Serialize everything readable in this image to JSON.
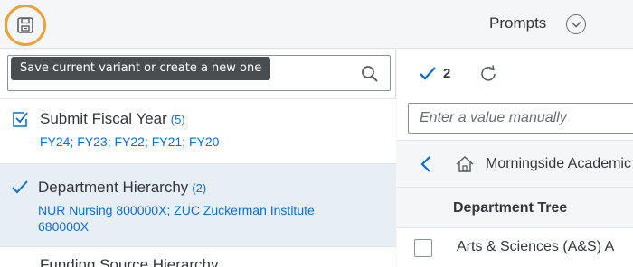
{
  "toolbar": {
    "save_icon": "floppy-disk-icon",
    "prompts_label": "Prompts",
    "prompts_icon": "chevron-down-circle-icon"
  },
  "tooltip": {
    "text": "Save current variant or create a new one"
  },
  "left_panel": {
    "search": {
      "value": "",
      "placeholder": "",
      "icon": "search-icon"
    },
    "items": [
      {
        "title": "Submit Fiscal Year",
        "count": "(5)",
        "values": "FY24; FY23; FY22; FY21; FY20",
        "state_icon": "checkbox-checked-icon"
      },
      {
        "title": "Department Hierarchy",
        "count": "(2)",
        "values": "NUR Nursing 800000X; ZUC Zuckerman Institute 680000X",
        "state_icon": "check-icon"
      },
      {
        "title": "Funding Source Hierarchy",
        "count": "",
        "values": "",
        "state_icon": ""
      }
    ]
  },
  "right_panel": {
    "selected_count": "2",
    "manual_input": {
      "placeholder": "Enter a value manually",
      "value": ""
    },
    "breadcrumb": "Morningside Academic",
    "column_header": "Department Tree",
    "rows": [
      {
        "label": "Arts & Sciences (A&S) A",
        "checked": false
      }
    ]
  },
  "colors": {
    "accent": "#0a6ed1",
    "highlight_ring": "#f0a03a",
    "selected_row_bg": "#e8eef5",
    "tooltip_bg": "#4a4d50"
  }
}
